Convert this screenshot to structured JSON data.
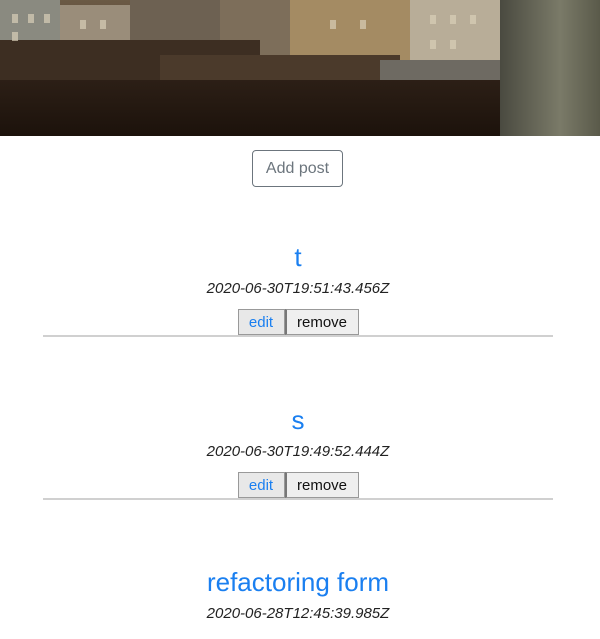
{
  "header": {
    "hero_image": "city-rooftops-photo"
  },
  "toolbar": {
    "add_post_label": "Add post"
  },
  "posts": [
    {
      "title": "t",
      "date": "2020-06-30T19:51:43.456Z",
      "edit_label": "edit",
      "remove_label": "remove"
    },
    {
      "title": "s",
      "date": "2020-06-30T19:49:52.444Z",
      "edit_label": "edit",
      "remove_label": "remove"
    },
    {
      "title": "refactoring form",
      "date": "2020-06-28T12:45:39.985Z"
    }
  ],
  "colors": {
    "link": "#1a7ff0",
    "secondary": "#6c757d"
  }
}
